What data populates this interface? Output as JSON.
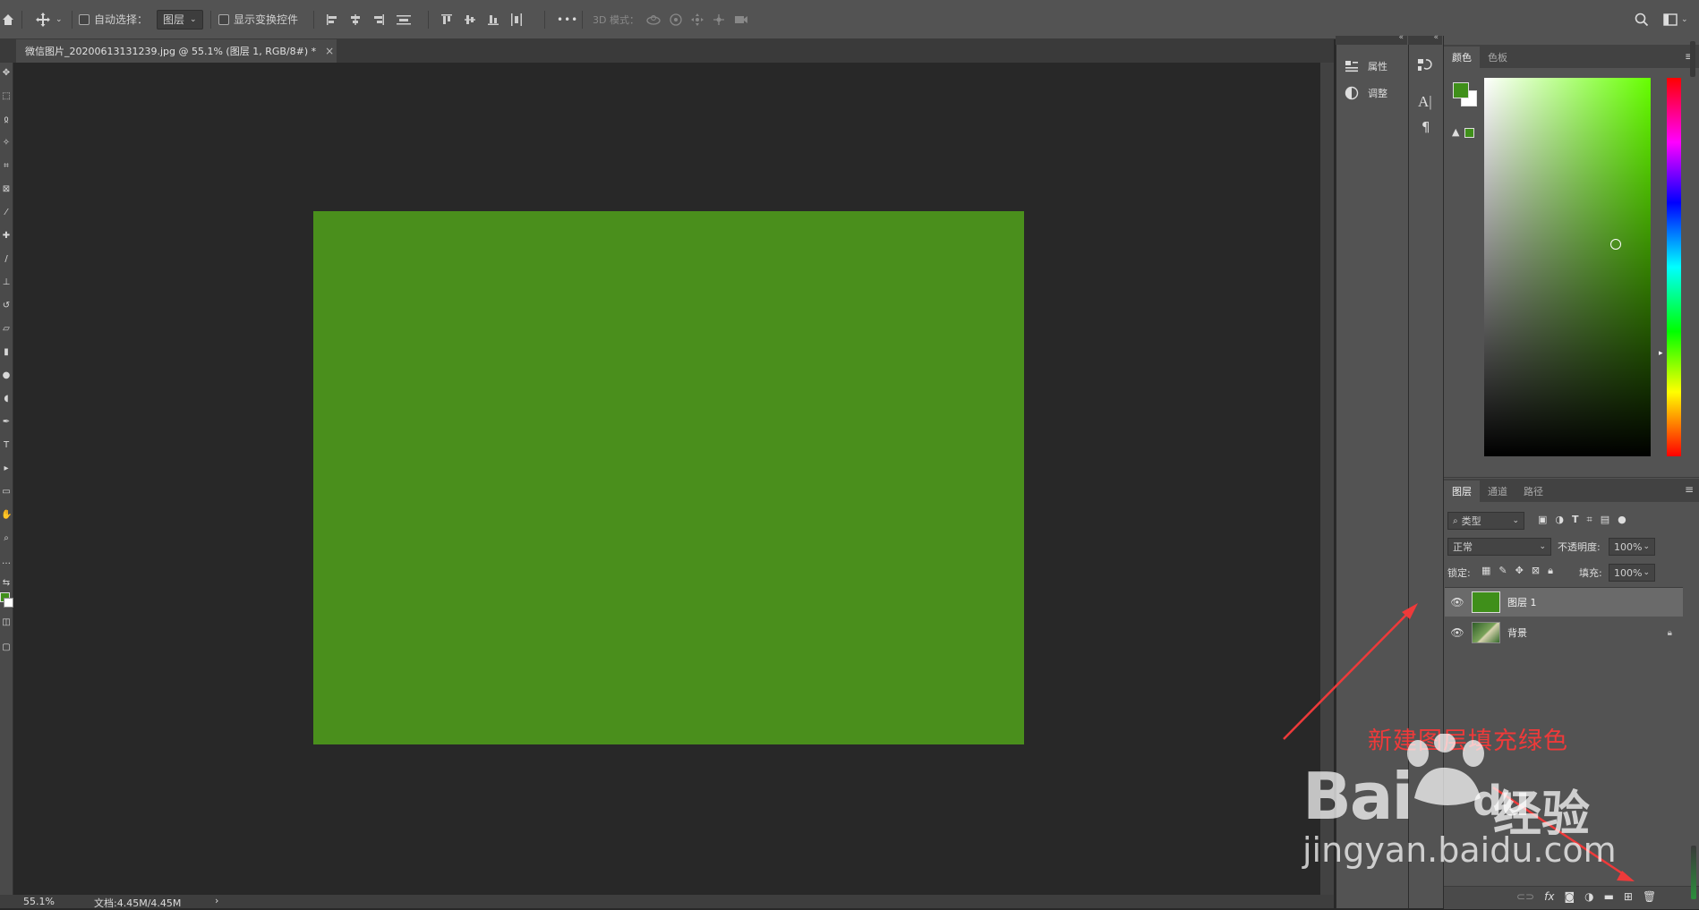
{
  "options_bar": {
    "auto_select_label": "自动选择：",
    "auto_select_target": "图层",
    "show_transform_label": "显示变换控件",
    "mode_3d_label": "3D 模式：",
    "more_glyph": "•••"
  },
  "document": {
    "tab_title": "微信图片_20200613131239.jpg @ 55.1% (图层 1, RGB/8#) *",
    "tab_close": "×",
    "canvas_fill_color": "#4a8f1c"
  },
  "status_bar": {
    "zoom": "55.1%",
    "doc_info": "文档:4.45M/4.45M",
    "arrow": "›"
  },
  "dock": {
    "properties_label": "属性",
    "adjustments_label": "调整"
  },
  "color_panel": {
    "tabs": [
      "颜色",
      "色板"
    ],
    "foreground_color": "#3f8f1a",
    "background_color": "#ffffff"
  },
  "layers_panel": {
    "tabs": [
      "图层",
      "通道",
      "路径"
    ],
    "filter_kind": "类型",
    "blend_mode": "正常",
    "opacity_label": "不透明度:",
    "opacity_value": "100%",
    "lock_label": "锁定:",
    "fill_label": "填充:",
    "fill_value": "100%",
    "layers": [
      {
        "name": "图层 1",
        "selected": true,
        "thumb_color": "#3f8f1a"
      },
      {
        "name": "背景",
        "selected": false,
        "locked": true
      }
    ]
  },
  "annotation": {
    "text": "新建图层填充绿色",
    "color": "#ee3a3a"
  },
  "watermark": {
    "brand_latin": "Bai",
    "brand_du": "du",
    "brand_cn": "经验",
    "url": "jingyan.baidu.com"
  }
}
